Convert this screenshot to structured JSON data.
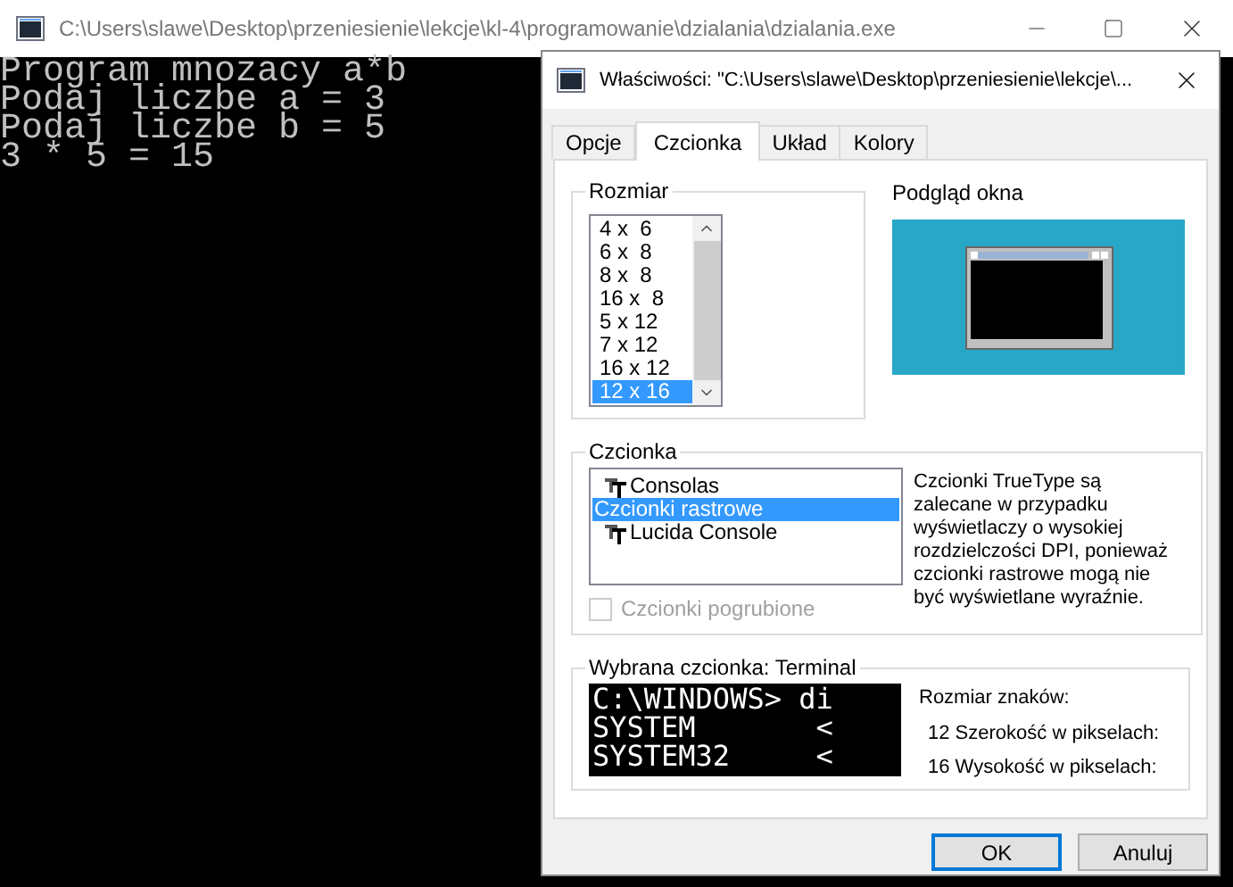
{
  "console_window": {
    "title": "C:\\Users\\slawe\\Desktop\\przeniesienie\\lekcje\\kl-4\\programowanie\\dzialania\\dzialania.exe",
    "lines": [
      "Program mnozacy a*b",
      "Podaj liczbe a = 3",
      "Podaj liczbe b = 5",
      "3 * 5 = 15"
    ]
  },
  "dialog": {
    "title": "Właściwości: \"C:\\Users\\slawe\\Desktop\\przeniesienie\\lekcje\\...",
    "tabs": [
      {
        "label": "Opcje",
        "selected": false
      },
      {
        "label": "Czcionka",
        "selected": true
      },
      {
        "label": "Układ",
        "selected": false
      },
      {
        "label": "Kolory",
        "selected": false
      }
    ],
    "size_group": {
      "label": "Rozmiar",
      "items": [
        {
          "label": "4 x  6",
          "selected": false
        },
        {
          "label": "6 x  8",
          "selected": false
        },
        {
          "label": "8 x  8",
          "selected": false
        },
        {
          "label": "16 x  8",
          "selected": false
        },
        {
          "label": "5 x 12",
          "selected": false
        },
        {
          "label": "7 x 12",
          "selected": false
        },
        {
          "label": "16 x 12",
          "selected": false
        },
        {
          "label": "12 x 16",
          "selected": true
        }
      ]
    },
    "preview": {
      "label": "Podgląd okna"
    },
    "font_group": {
      "label": "Czcionka",
      "items": [
        {
          "label": "Consolas",
          "kind": "truetype",
          "selected": false
        },
        {
          "label": "Czcionki rastrowe",
          "kind": "raster",
          "selected": true
        },
        {
          "label": "Lucida Console",
          "kind": "truetype",
          "selected": false
        }
      ],
      "bold_checkbox": {
        "label": "Czcionki pogrubione",
        "checked": false,
        "disabled": true
      },
      "note": "Czcionki TrueType są zalecane w przypadku wyświetlaczy o wysokiej rozdzielczości DPI, ponieważ czcionki rastrowe mogą nie być wyświetlane wyraźnie."
    },
    "selected_font": {
      "label": "Wybrana czcionka: Terminal",
      "sample_lines": [
        "C:\\WINDOWS> di",
        "SYSTEM       <",
        "SYSTEM32     <"
      ],
      "size_label": "Rozmiar znaków:",
      "metrics": [
        "12 Szerokość w pikselach:",
        "16 Wysokość w pikselach:"
      ]
    },
    "buttons": [
      {
        "label": "OK",
        "default": true
      },
      {
        "label": "Anuluj",
        "default": false
      }
    ]
  }
}
